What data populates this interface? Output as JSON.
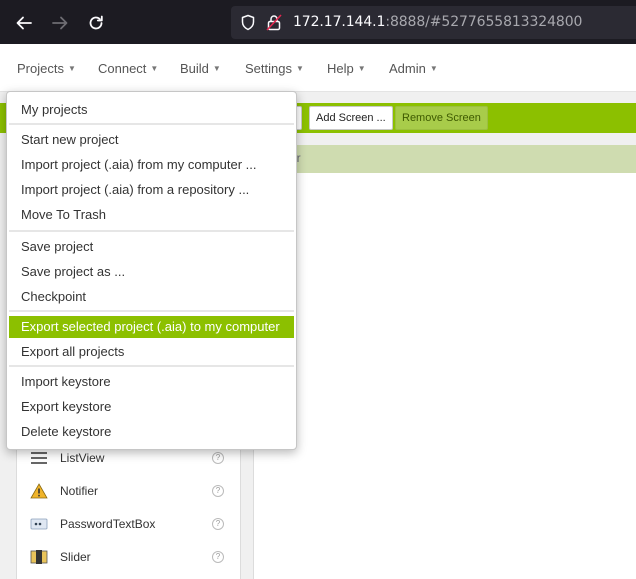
{
  "browser": {
    "url_host": "172.17.144.1",
    "url_rest": ":8888/#5277655813324800",
    "icons": [
      "back-arrow-icon",
      "forward-arrow-icon",
      "reload-icon",
      "shield-icon",
      "lock-icon"
    ]
  },
  "menu_bar": {
    "items": [
      {
        "label": "Projects"
      },
      {
        "label": "Connect"
      },
      {
        "label": "Build"
      },
      {
        "label": "Settings"
      },
      {
        "label": "Help"
      },
      {
        "label": "Admin"
      }
    ]
  },
  "toolbar": {
    "add_screen": "Add Screen ...",
    "remove_screen": "Remove Screen",
    "color": "#8cc000"
  },
  "viewer": {
    "header_partial": "er"
  },
  "palette": {
    "items": [
      {
        "label": "ListView",
        "icon": "listview-icon",
        "help": "?"
      },
      {
        "label": "Notifier",
        "icon": "warning-icon",
        "help": "?"
      },
      {
        "label": "PasswordTextBox",
        "icon": "password-icon",
        "help": "?"
      },
      {
        "label": "Slider",
        "icon": "slider-icon",
        "help": "?"
      }
    ]
  },
  "projects_menu": {
    "items": [
      {
        "label": "My projects"
      },
      {
        "label": "Start new project"
      },
      {
        "label": "Import project (.aia) from my computer ..."
      },
      {
        "label": "Import project (.aia) from a repository ..."
      },
      {
        "label": "Move To Trash"
      },
      {
        "label": "Save project"
      },
      {
        "label": "Save project as ..."
      },
      {
        "label": "Checkpoint"
      },
      {
        "label": "Export selected project (.aia) to my computer",
        "highlighted": true
      },
      {
        "label": "Export all projects"
      },
      {
        "label": "Import keystore"
      },
      {
        "label": "Export keystore"
      },
      {
        "label": "Delete keystore"
      }
    ],
    "highlight_color": "#8cc000"
  }
}
